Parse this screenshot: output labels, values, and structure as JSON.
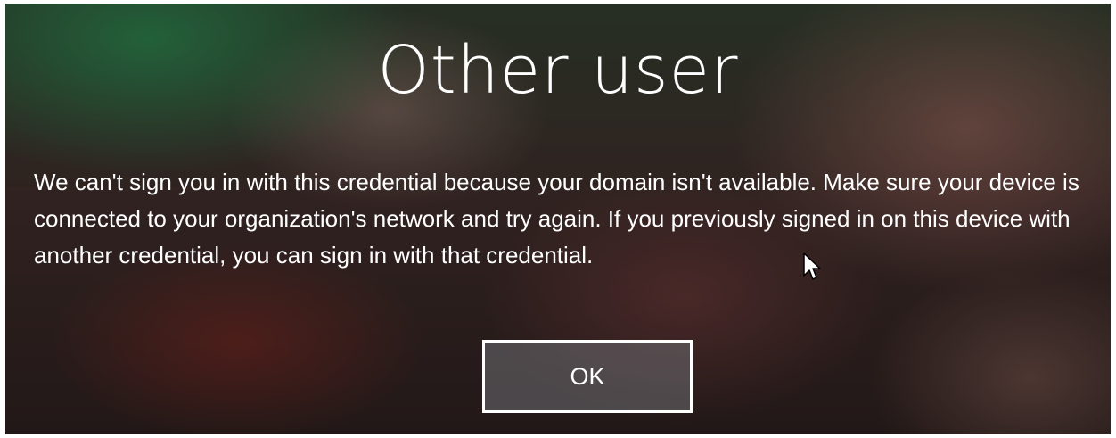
{
  "dialog": {
    "title": "Other user",
    "message": "We can't sign you in with this credential because your domain isn't available. Make sure your device is connected to your organization's network and try again. If you previously signed in on this device with another credential, you can sign in with that credential.",
    "ok_label": "OK"
  },
  "icons": {
    "pointer": "mouse-pointer-icon"
  },
  "colors": {
    "text": "#ffffff",
    "button_border": "#ffffff"
  }
}
